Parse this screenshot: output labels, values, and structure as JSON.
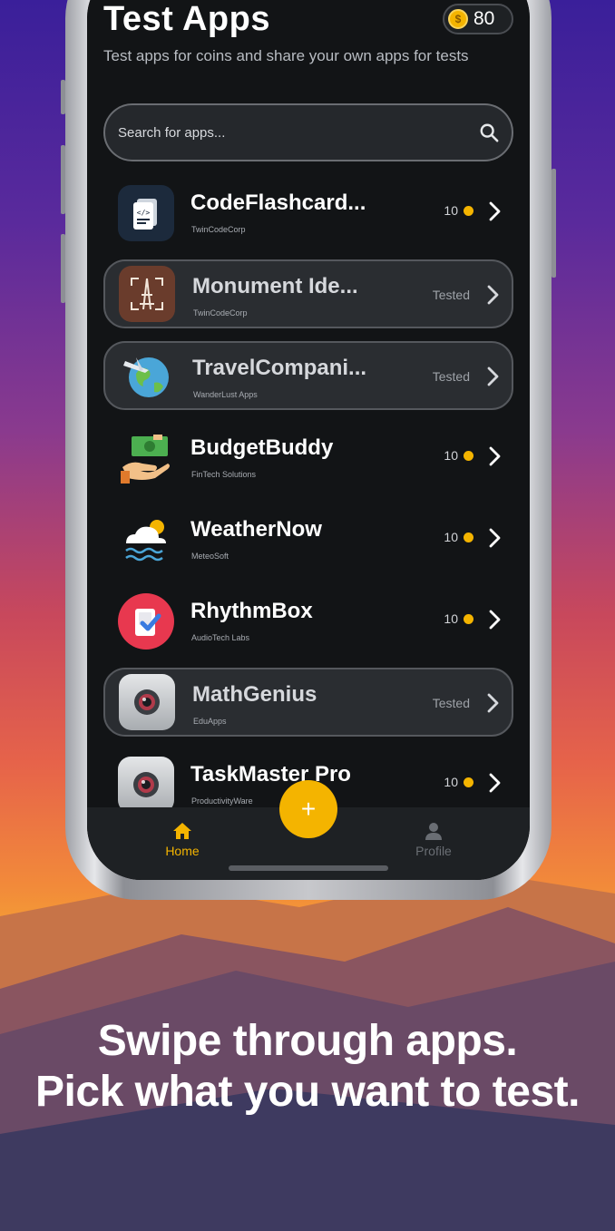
{
  "header": {
    "title": "Test Apps",
    "coin_balance": "80",
    "coin_icon": "dollar-coin-icon",
    "subtitle": "Test apps for coins and share your own apps for tests"
  },
  "search": {
    "placeholder": "Search for apps..."
  },
  "apps": [
    {
      "name": "CodeFlashcard...",
      "developer": "TwinCodeCorp",
      "reward": "10",
      "tested": false,
      "icon": "code-flashcard-icon"
    },
    {
      "name": "Monument Ide...",
      "developer": "TwinCodeCorp",
      "status": "Tested",
      "tested": true,
      "icon": "eiffel-tower-icon"
    },
    {
      "name": "TravelCompani...",
      "developer": "WanderLust Apps",
      "status": "Tested",
      "tested": true,
      "icon": "globe-plane-icon"
    },
    {
      "name": "BudgetBuddy",
      "developer": "FinTech Solutions",
      "reward": "10",
      "tested": false,
      "icon": "money-hand-icon"
    },
    {
      "name": "WeatherNow",
      "developer": "MeteoSoft",
      "reward": "10",
      "tested": false,
      "icon": "cloud-weather-icon"
    },
    {
      "name": "RhythmBox",
      "developer": "AudioTech Labs",
      "reward": "10",
      "tested": false,
      "icon": "rhythm-box-icon"
    },
    {
      "name": "MathGenius",
      "developer": "EduApps",
      "status": "Tested",
      "tested": true,
      "icon": "camera-lens-icon"
    },
    {
      "name": "TaskMaster Pro",
      "developer": "ProductivityWare",
      "reward": "10",
      "tested": false,
      "icon": "camera-lens-icon"
    }
  ],
  "nav": {
    "home_label": "Home",
    "profile_label": "Profile",
    "add_label": "+"
  },
  "caption": {
    "line1": "Swipe through apps.",
    "line2": "Pick what you want to test."
  },
  "colors": {
    "accent": "#f4b400",
    "background": "#121416"
  }
}
